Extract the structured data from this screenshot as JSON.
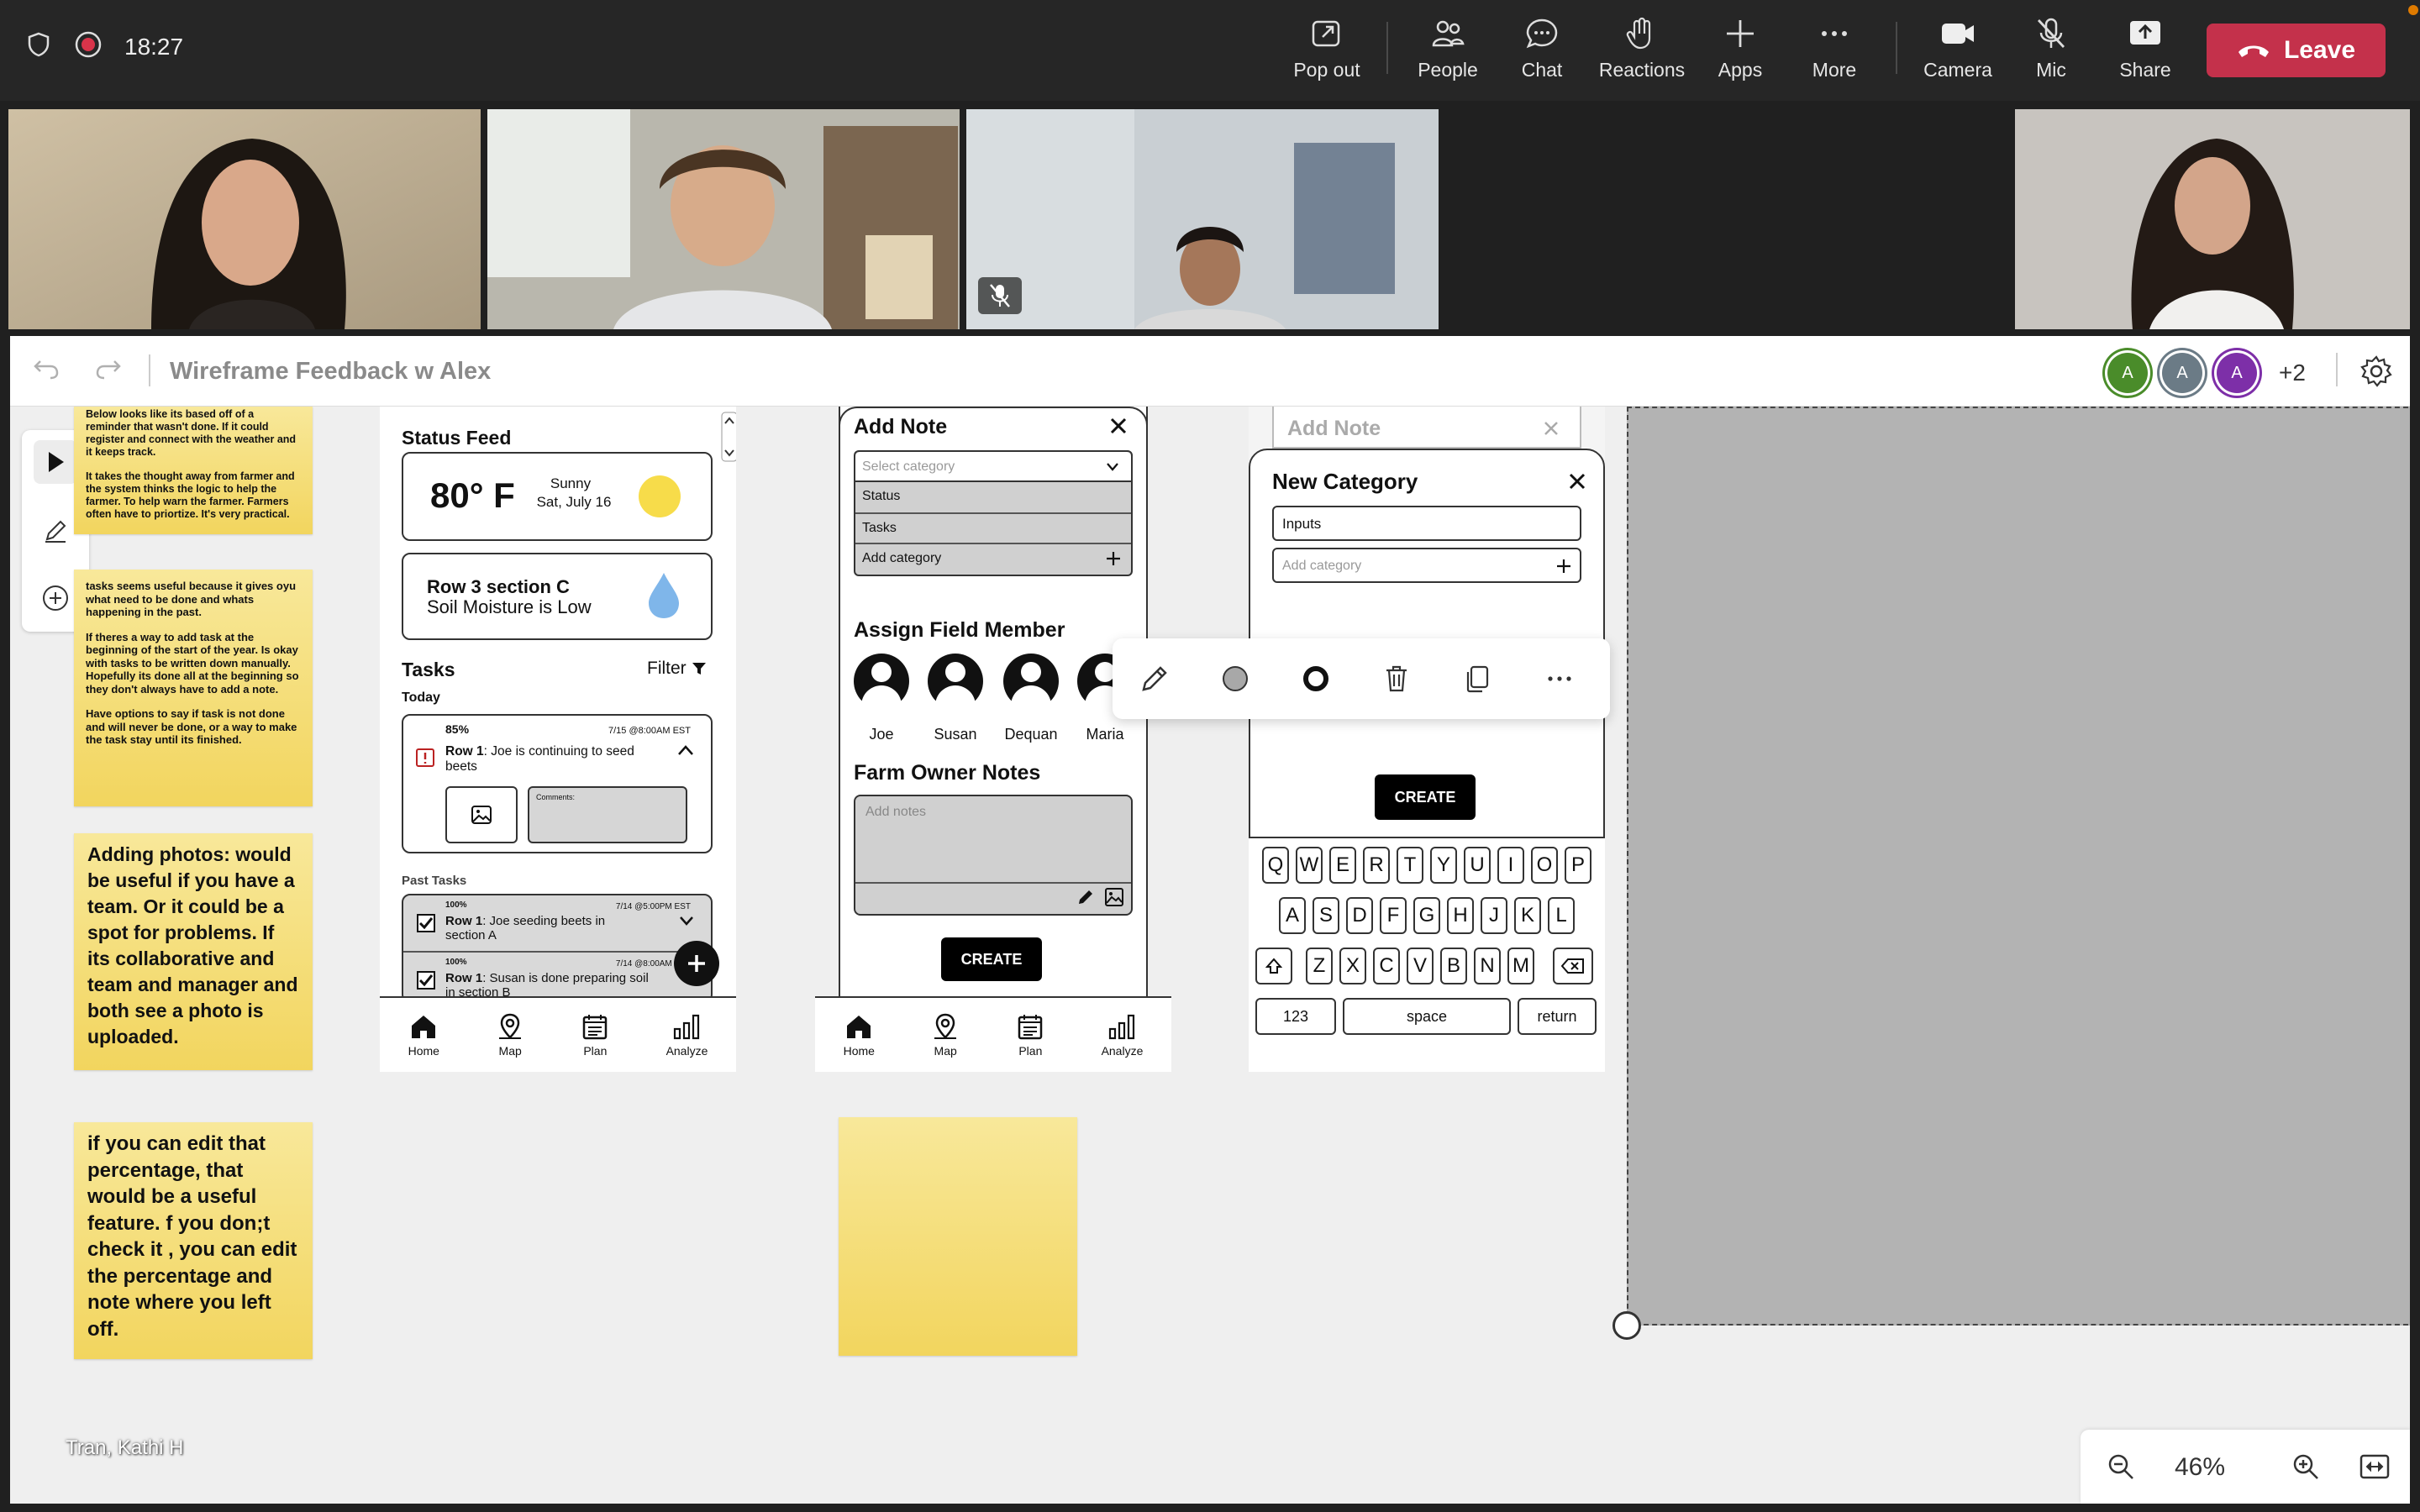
{
  "meeting": {
    "time": "18:27",
    "controls": {
      "pop_out": "Pop out",
      "people": "People",
      "chat": "Chat",
      "reactions": "Reactions",
      "apps": "Apps",
      "more": "More",
      "camera": "Camera",
      "mic": "Mic",
      "share": "Share",
      "leave": "Leave"
    },
    "presenter_name": "Tran, Kathi H"
  },
  "whiteboard": {
    "title": "Wireframe Feedback w Alex",
    "collaborators": [
      {
        "initial": "A",
        "color": "#4a8c2a"
      },
      {
        "initial": "A",
        "color": "#6b7b86"
      },
      {
        "initial": "A",
        "color": "#7d2fa8"
      }
    ],
    "extra_collaborators": "+2",
    "zoom": "46%"
  },
  "notes": {
    "n1": {
      "p1": "Below looks like its based off of a reminder that wasn't done. If it could register and connect with the weather and it keeps track.",
      "p2": "It takes the thought away from farmer and the system thinks the logic to help the farmer. To help warn the farmer. Farmers often have to priortize. It's very practical."
    },
    "n2": {
      "p1": "tasks seems useful because it gives oyu what need to be done and whats happening in the past.",
      "p2": "If theres a way to add task at the beginning of the start of the year. Is okay with tasks to be written down manually. Hopefully its done all at the beginning so they don't always have to add a note.",
      "p3": "Have options to say if task is not done and will never be done, or a way to make the task stay until its finished."
    },
    "n3": "Adding photos: would be useful if you have a team. Or it could be a spot for problems. If its collaborative and team and manager and both see a photo is uploaded.",
    "n4": "if you can edit that percentage, that would be a useful feature. f you don;t check it , you can edit the percentage and note where you left off."
  },
  "phone1": {
    "status_feed": "Status Feed",
    "temp": "80° F",
    "weather": "Sunny",
    "date": "Sat, July 16",
    "row_title": "Row 3 section C",
    "moisture": "Soil Moisture is Low",
    "tasks": "Tasks",
    "filter": "Filter",
    "today": "Today",
    "task_pct": "85%",
    "task_time": "7/15 @8:00AM EST",
    "task_row": "Row 1",
    "task_text": ": Joe is continuing to seed beets",
    "comments": "Comments:",
    "past_tasks": "Past Tasks",
    "past1_pct": "100%",
    "past1_time": "7/14 @5:00PM EST",
    "past1_row": "Row 1",
    "past1_text": ": Joe seeding beets in section A",
    "past2_pct": "100%",
    "past2_time": "7/14 @8:00AM EST",
    "past2_row": "Row 1",
    "past2_text": ": Susan is done preparing soil in section B"
  },
  "nav": {
    "home": "Home",
    "map": "Map",
    "plan": "Plan",
    "analyze": "Analyze"
  },
  "phone2": {
    "title": "Add Note",
    "select_placeholder": "Select category",
    "opt_status": "Status",
    "opt_tasks": "Tasks",
    "opt_add": "Add category",
    "assign": "Assign Field Member",
    "members": [
      "Joe",
      "Susan",
      "Dequan",
      "Maria"
    ],
    "owner_notes": "Farm Owner Notes",
    "notes_placeholder": "Add notes",
    "create": "CREATE"
  },
  "phone3": {
    "add_note": "Add Note",
    "title": "New Category",
    "inputs": "Inputs",
    "add_category": "Add category",
    "create": "CREATE",
    "row1": [
      "Q",
      "W",
      "E",
      "R",
      "T",
      "Y",
      "U",
      "I",
      "O",
      "P"
    ],
    "row2": [
      "A",
      "S",
      "D",
      "F",
      "G",
      "H",
      "J",
      "K",
      "L"
    ],
    "row3": [
      "Z",
      "X",
      "C",
      "V",
      "B",
      "N",
      "M"
    ],
    "k123": "123",
    "space": "space",
    "return": "return"
  }
}
